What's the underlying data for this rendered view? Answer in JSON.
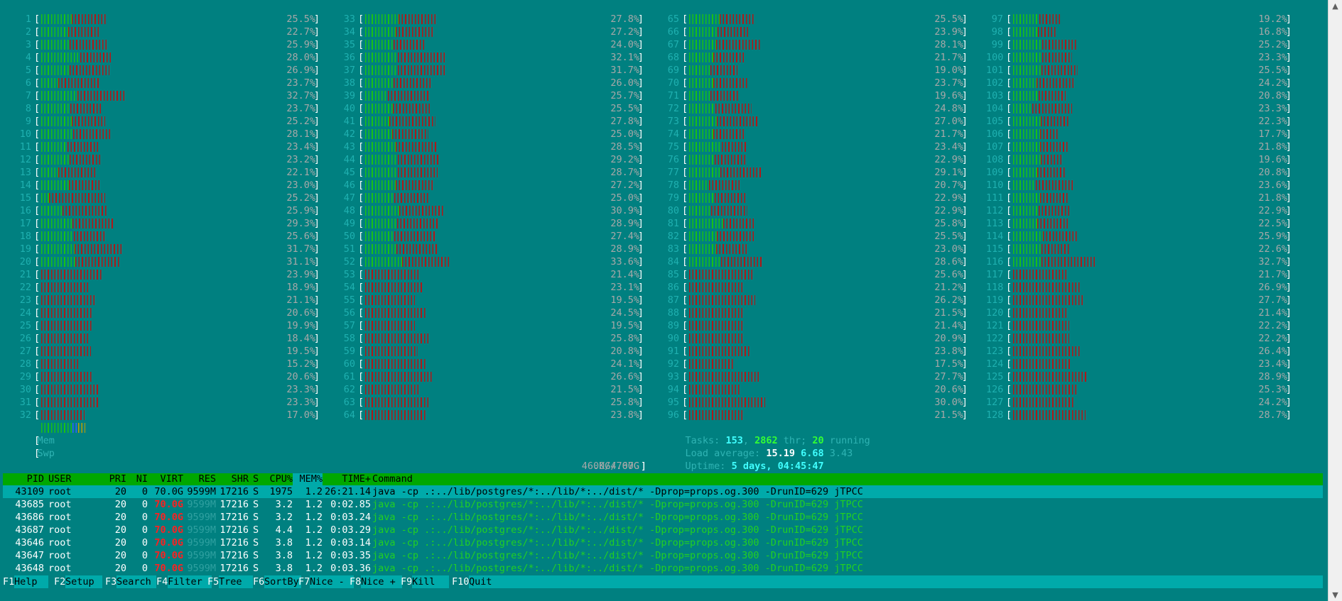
{
  "colors": {
    "background": "#008080",
    "bar_normal": "#18c018",
    "bar_kernel": "#b01818",
    "header": "#00a800",
    "selected": "#00aaaa",
    "virt_highlight": "#ff2020"
  },
  "cpus": [
    {
      "n": "1",
      "pct": "25.5%",
      "g": 0.47,
      "r": 0.53
    },
    {
      "n": "2",
      "pct": "22.7%",
      "g": 0.47,
      "r": 0.53
    },
    {
      "n": "3",
      "pct": "25.9%",
      "g": 0.43,
      "r": 0.57
    },
    {
      "n": "4",
      "pct": "28.0%",
      "g": 0.55,
      "r": 0.45
    },
    {
      "n": "5",
      "pct": "26.9%",
      "g": 0.42,
      "r": 0.58
    },
    {
      "n": "6",
      "pct": "23.7%",
      "g": 0.29,
      "r": 0.71
    },
    {
      "n": "7",
      "pct": "32.7%",
      "g": 0.44,
      "r": 0.56
    },
    {
      "n": "8",
      "pct": "23.7%",
      "g": 0.49,
      "r": 0.51
    },
    {
      "n": "9",
      "pct": "25.2%",
      "g": 0.48,
      "r": 0.52
    },
    {
      "n": "10",
      "pct": "28.1%",
      "g": 0.45,
      "r": 0.55
    },
    {
      "n": "11",
      "pct": "23.4%",
      "g": 0.45,
      "r": 0.55
    },
    {
      "n": "12",
      "pct": "23.2%",
      "g": 0.48,
      "r": 0.52
    },
    {
      "n": "13",
      "pct": "22.1%",
      "g": 0.31,
      "r": 0.69
    },
    {
      "n": "14",
      "pct": "23.0%",
      "g": 0.47,
      "r": 0.53
    },
    {
      "n": "15",
      "pct": "25.2%",
      "g": 0.12,
      "r": 0.88
    },
    {
      "n": "16",
      "pct": "25.9%",
      "g": 0.33,
      "r": 0.67
    },
    {
      "n": "17",
      "pct": "29.3%",
      "g": 0.42,
      "r": 0.58
    },
    {
      "n": "18",
      "pct": "25.6%",
      "g": 0.5,
      "r": 0.5
    },
    {
      "n": "19",
      "pct": "31.7%",
      "g": 0.42,
      "r": 0.58
    },
    {
      "n": "20",
      "pct": "31.1%",
      "g": 0.43,
      "r": 0.57
    },
    {
      "n": "21",
      "pct": "23.9%",
      "g": 0,
      "r": 1
    },
    {
      "n": "22",
      "pct": "18.9%",
      "g": 0,
      "r": 1
    },
    {
      "n": "23",
      "pct": "21.1%",
      "g": 0,
      "r": 1
    },
    {
      "n": "24",
      "pct": "20.6%",
      "g": 0,
      "r": 1
    },
    {
      "n": "25",
      "pct": "19.9%",
      "g": 0,
      "r": 1
    },
    {
      "n": "26",
      "pct": "18.4%",
      "g": 0,
      "r": 1
    },
    {
      "n": "27",
      "pct": "19.5%",
      "g": 0,
      "r": 1
    },
    {
      "n": "28",
      "pct": "15.2%",
      "g": 0,
      "r": 1
    },
    {
      "n": "29",
      "pct": "20.6%",
      "g": 0,
      "r": 1
    },
    {
      "n": "30",
      "pct": "23.3%",
      "g": 0,
      "r": 1
    },
    {
      "n": "31",
      "pct": "23.3%",
      "g": 0,
      "r": 1
    },
    {
      "n": "32",
      "pct": "17.0%",
      "g": 0,
      "r": 1
    },
    {
      "n": "33",
      "pct": "27.8%",
      "g": 0.47,
      "r": 0.53
    },
    {
      "n": "34",
      "pct": "27.2%",
      "g": 0.44,
      "r": 0.56
    },
    {
      "n": "35",
      "pct": "24.0%",
      "g": 0.46,
      "r": 0.54
    },
    {
      "n": "36",
      "pct": "32.1%",
      "g": 0.4,
      "r": 0.6
    },
    {
      "n": "37",
      "pct": "31.7%",
      "g": 0.41,
      "r": 0.59
    },
    {
      "n": "38",
      "pct": "26.0%",
      "g": 0.43,
      "r": 0.57
    },
    {
      "n": "39",
      "pct": "25.7%",
      "g": 0.35,
      "r": 0.65
    },
    {
      "n": "40",
      "pct": "25.5%",
      "g": 0.43,
      "r": 0.57
    },
    {
      "n": "41",
      "pct": "27.8%",
      "g": 0.34,
      "r": 0.66
    },
    {
      "n": "42",
      "pct": "25.0%",
      "g": 0.43,
      "r": 0.57
    },
    {
      "n": "43",
      "pct": "28.5%",
      "g": 0.42,
      "r": 0.58
    },
    {
      "n": "44",
      "pct": "29.2%",
      "g": 0.44,
      "r": 0.56
    },
    {
      "n": "45",
      "pct": "28.7%",
      "g": 0.45,
      "r": 0.55
    },
    {
      "n": "46",
      "pct": "27.2%",
      "g": 0.44,
      "r": 0.56
    },
    {
      "n": "47",
      "pct": "25.0%",
      "g": 0.46,
      "r": 0.54
    },
    {
      "n": "48",
      "pct": "30.9%",
      "g": 0.44,
      "r": 0.56
    },
    {
      "n": "49",
      "pct": "28.9%",
      "g": 0.44,
      "r": 0.56
    },
    {
      "n": "50",
      "pct": "27.4%",
      "g": 0.42,
      "r": 0.58
    },
    {
      "n": "51",
      "pct": "28.9%",
      "g": 0.43,
      "r": 0.57
    },
    {
      "n": "52",
      "pct": "33.6%",
      "g": 0.43,
      "r": 0.57
    },
    {
      "n": "53",
      "pct": "21.4%",
      "g": 0,
      "r": 1
    },
    {
      "n": "54",
      "pct": "23.1%",
      "g": 0,
      "r": 1
    },
    {
      "n": "55",
      "pct": "19.5%",
      "g": 0,
      "r": 1
    },
    {
      "n": "56",
      "pct": "24.5%",
      "g": 0,
      "r": 1
    },
    {
      "n": "57",
      "pct": "19.5%",
      "g": 0,
      "r": 1
    },
    {
      "n": "58",
      "pct": "25.8%",
      "g": 0,
      "r": 1
    },
    {
      "n": "59",
      "pct": "20.8%",
      "g": 0,
      "r": 1
    },
    {
      "n": "60",
      "pct": "24.1%",
      "g": 0,
      "r": 1
    },
    {
      "n": "61",
      "pct": "26.6%",
      "g": 0,
      "r": 1
    },
    {
      "n": "62",
      "pct": "21.5%",
      "g": 0,
      "r": 1
    },
    {
      "n": "63",
      "pct": "25.8%",
      "g": 0,
      "r": 1
    },
    {
      "n": "64",
      "pct": "23.8%",
      "g": 0,
      "r": 1
    },
    {
      "n": "65",
      "pct": "25.5%",
      "g": 0.47,
      "r": 0.53
    },
    {
      "n": "66",
      "pct": "23.9%",
      "g": 0.47,
      "r": 0.53
    },
    {
      "n": "67",
      "pct": "28.1%",
      "g": 0.38,
      "r": 0.62
    },
    {
      "n": "68",
      "pct": "21.7%",
      "g": 0.44,
      "r": 0.56
    },
    {
      "n": "69",
      "pct": "19.0%",
      "g": 0.44,
      "r": 0.56
    },
    {
      "n": "70",
      "pct": "23.7%",
      "g": 0.41,
      "r": 0.59
    },
    {
      "n": "71",
      "pct": "19.6%",
      "g": 0.43,
      "r": 0.57
    },
    {
      "n": "72",
      "pct": "24.8%",
      "g": 0.42,
      "r": 0.58
    },
    {
      "n": "73",
      "pct": "27.0%",
      "g": 0.41,
      "r": 0.59
    },
    {
      "n": "74",
      "pct": "21.7%",
      "g": 0.44,
      "r": 0.56
    },
    {
      "n": "75",
      "pct": "23.4%",
      "g": 0.55,
      "r": 0.45
    },
    {
      "n": "76",
      "pct": "22.9%",
      "g": 0.44,
      "r": 0.56
    },
    {
      "n": "77",
      "pct": "29.1%",
      "g": 0.42,
      "r": 0.58
    },
    {
      "n": "78",
      "pct": "20.7%",
      "g": 0.38,
      "r": 0.62
    },
    {
      "n": "79",
      "pct": "22.9%",
      "g": 0.44,
      "r": 0.56
    },
    {
      "n": "80",
      "pct": "22.9%",
      "g": 0.38,
      "r": 0.62
    },
    {
      "n": "81",
      "pct": "25.8%",
      "g": 0.52,
      "r": 0.48
    },
    {
      "n": "82",
      "pct": "25.5%",
      "g": 0.43,
      "r": 0.57
    },
    {
      "n": "83",
      "pct": "23.0%",
      "g": 0.46,
      "r": 0.54
    },
    {
      "n": "84",
      "pct": "28.6%",
      "g": 0.44,
      "r": 0.56
    },
    {
      "n": "85",
      "pct": "25.6%",
      "g": 0,
      "r": 1
    },
    {
      "n": "86",
      "pct": "21.2%",
      "g": 0,
      "r": 1
    },
    {
      "n": "87",
      "pct": "26.2%",
      "g": 0,
      "r": 1
    },
    {
      "n": "88",
      "pct": "21.5%",
      "g": 0,
      "r": 1
    },
    {
      "n": "89",
      "pct": "21.4%",
      "g": 0,
      "r": 1
    },
    {
      "n": "90",
      "pct": "20.9%",
      "g": 0,
      "r": 1
    },
    {
      "n": "91",
      "pct": "23.8%",
      "g": 0,
      "r": 1
    },
    {
      "n": "92",
      "pct": "17.5%",
      "g": 0,
      "r": 1
    },
    {
      "n": "93",
      "pct": "27.7%",
      "g": 0,
      "r": 1
    },
    {
      "n": "94",
      "pct": "20.6%",
      "g": 0,
      "r": 1
    },
    {
      "n": "95",
      "pct": "30.0%",
      "g": 0,
      "r": 1
    },
    {
      "n": "96",
      "pct": "21.5%",
      "g": 0,
      "r": 1
    },
    {
      "n": "97",
      "pct": "19.2%",
      "g": 0.54,
      "r": 0.46
    },
    {
      "n": "98",
      "pct": "16.8%",
      "g": 0.58,
      "r": 0.42
    },
    {
      "n": "99",
      "pct": "25.2%",
      "g": 0.46,
      "r": 0.54
    },
    {
      "n": "100",
      "pct": "23.3%",
      "g": 0.49,
      "r": 0.51
    },
    {
      "n": "101",
      "pct": "25.5%",
      "g": 0.44,
      "r": 0.56
    },
    {
      "n": "102",
      "pct": "24.2%",
      "g": 0.38,
      "r": 0.62
    },
    {
      "n": "103",
      "pct": "20.8%",
      "g": 0.49,
      "r": 0.51
    },
    {
      "n": "104",
      "pct": "23.3%",
      "g": 0.32,
      "r": 0.68
    },
    {
      "n": "105",
      "pct": "22.3%",
      "g": 0.49,
      "r": 0.51
    },
    {
      "n": "106",
      "pct": "17.7%",
      "g": 0.6,
      "r": 0.4
    },
    {
      "n": "107",
      "pct": "21.8%",
      "g": 0.49,
      "r": 0.51
    },
    {
      "n": "108",
      "pct": "19.6%",
      "g": 0.56,
      "r": 0.44
    },
    {
      "n": "109",
      "pct": "20.8%",
      "g": 0.46,
      "r": 0.54
    },
    {
      "n": "110",
      "pct": "23.6%",
      "g": 0.38,
      "r": 0.62
    },
    {
      "n": "111",
      "pct": "21.8%",
      "g": 0.49,
      "r": 0.51
    },
    {
      "n": "112",
      "pct": "22.9%",
      "g": 0.44,
      "r": 0.56
    },
    {
      "n": "113",
      "pct": "22.5%",
      "g": 0.42,
      "r": 0.58
    },
    {
      "n": "114",
      "pct": "25.9%",
      "g": 0.46,
      "r": 0.54
    },
    {
      "n": "115",
      "pct": "22.6%",
      "g": 0.49,
      "r": 0.51
    },
    {
      "n": "116",
      "pct": "32.7%",
      "g": 0.34,
      "r": 0.66
    },
    {
      "n": "117",
      "pct": "21.7%",
      "g": 0,
      "r": 1
    },
    {
      "n": "118",
      "pct": "26.9%",
      "g": 0,
      "r": 1
    },
    {
      "n": "119",
      "pct": "27.7%",
      "g": 0,
      "r": 1
    },
    {
      "n": "120",
      "pct": "21.4%",
      "g": 0,
      "r": 1
    },
    {
      "n": "121",
      "pct": "22.2%",
      "g": 0,
      "r": 1
    },
    {
      "n": "122",
      "pct": "22.2%",
      "g": 0,
      "r": 1
    },
    {
      "n": "123",
      "pct": "26.4%",
      "g": 0,
      "r": 1
    },
    {
      "n": "124",
      "pct": "23.4%",
      "g": 0,
      "r": 1
    },
    {
      "n": "125",
      "pct": "28.9%",
      "g": 0,
      "r": 1
    },
    {
      "n": "126",
      "pct": "25.3%",
      "g": 0,
      "r": 1
    },
    {
      "n": "127",
      "pct": "24.2%",
      "g": 0,
      "r": 1
    },
    {
      "n": "128",
      "pct": "28.7%",
      "g": 0,
      "r": 1
    }
  ],
  "memory": {
    "label": "Mem",
    "value": "46.0G/767G",
    "used_fraction": 0.06
  },
  "swap": {
    "label": "Swp",
    "value": "0K/4.00G",
    "used_fraction": 0
  },
  "tasks": {
    "label": "Tasks:",
    "count": "153",
    "sep": ",",
    "threads": "2862",
    "thr_label": "thr;",
    "running": "20",
    "running_label": "running"
  },
  "load": {
    "label": "Load average:",
    "one": "15.19",
    "five": "6.68",
    "fifteen": "3.43"
  },
  "uptime": {
    "label": "Uptime:",
    "value": "5 days, 04:45:47"
  },
  "proc_columns": [
    "PID",
    "USER",
    "PRI",
    "NI",
    "VIRT",
    "RES",
    "SHR",
    "S",
    "CPU%",
    "MEM%",
    "TIME+",
    "Command"
  ],
  "processes": [
    {
      "pid": "43109",
      "user": "root",
      "pri": "20",
      "ni": "0",
      "virt": "70.0G",
      "res": "9599M",
      "shr": "17216",
      "s": "S",
      "cpu": "1975",
      "mem": "1.2",
      "time": "26:21.14",
      "cmd": "java -cp .:../lib/postgres/*:../lib/*:../dist/* -Dprop=props.og.300 -DrunID=629 jTPCC"
    },
    {
      "pid": "43685",
      "user": "root",
      "pri": "20",
      "ni": "0",
      "virt": "70.0G",
      "res": "9599M",
      "shr": "17216",
      "s": "S",
      "cpu": "3.2",
      "mem": "1.2",
      "time": "0:02.85",
      "cmd": "java -cp .:../lib/postgres/*:../lib/*:../dist/* -Dprop=props.og.300 -DrunID=629 jTPCC"
    },
    {
      "pid": "43686",
      "user": "root",
      "pri": "20",
      "ni": "0",
      "virt": "70.0G",
      "res": "9599M",
      "shr": "17216",
      "s": "S",
      "cpu": "3.2",
      "mem": "1.2",
      "time": "0:03.24",
      "cmd": "java -cp .:../lib/postgres/*:../lib/*:../dist/* -Dprop=props.og.300 -DrunID=629 jTPCC"
    },
    {
      "pid": "43687",
      "user": "root",
      "pri": "20",
      "ni": "0",
      "virt": "70.0G",
      "res": "9599M",
      "shr": "17216",
      "s": "S",
      "cpu": "4.4",
      "mem": "1.2",
      "time": "0:03.29",
      "cmd": "java -cp .:../lib/postgres/*:../lib/*:../dist/* -Dprop=props.og.300 -DrunID=629 jTPCC"
    },
    {
      "pid": "43646",
      "user": "root",
      "pri": "20",
      "ni": "0",
      "virt": "70.0G",
      "res": "9599M",
      "shr": "17216",
      "s": "S",
      "cpu": "3.8",
      "mem": "1.2",
      "time": "0:03.14",
      "cmd": "java -cp .:../lib/postgres/*:../lib/*:../dist/* -Dprop=props.og.300 -DrunID=629 jTPCC"
    },
    {
      "pid": "43647",
      "user": "root",
      "pri": "20",
      "ni": "0",
      "virt": "70.0G",
      "res": "9599M",
      "shr": "17216",
      "s": "S",
      "cpu": "3.8",
      "mem": "1.2",
      "time": "0:03.35",
      "cmd": "java -cp .:../lib/postgres/*:../lib/*:../dist/* -Dprop=props.og.300 -DrunID=629 jTPCC"
    },
    {
      "pid": "43648",
      "user": "root",
      "pri": "20",
      "ni": "0",
      "virt": "70.0G",
      "res": "9599M",
      "shr": "17216",
      "s": "S",
      "cpu": "3.8",
      "mem": "1.2",
      "time": "0:03.36",
      "cmd": "java -cp .:../lib/postgres/*:../lib/*:../dist/* -Dprop=props.og.300 -DrunID=629 jTPCC"
    }
  ],
  "footer": [
    {
      "key": "F1",
      "label": "Help"
    },
    {
      "key": "F2",
      "label": "Setup"
    },
    {
      "key": "F3",
      "label": "Search"
    },
    {
      "key": "F4",
      "label": "Filter"
    },
    {
      "key": "F5",
      "label": "Tree"
    },
    {
      "key": "F6",
      "label": "SortBy"
    },
    {
      "key": "F7",
      "label": "Nice -"
    },
    {
      "key": "F8",
      "label": "Nice +"
    },
    {
      "key": "F9",
      "label": "Kill"
    },
    {
      "key": "F10",
      "label": "Quit"
    }
  ],
  "scrollbar": {
    "up_icon": "triangle-up-icon",
    "down_icon": "triangle-down-icon"
  }
}
